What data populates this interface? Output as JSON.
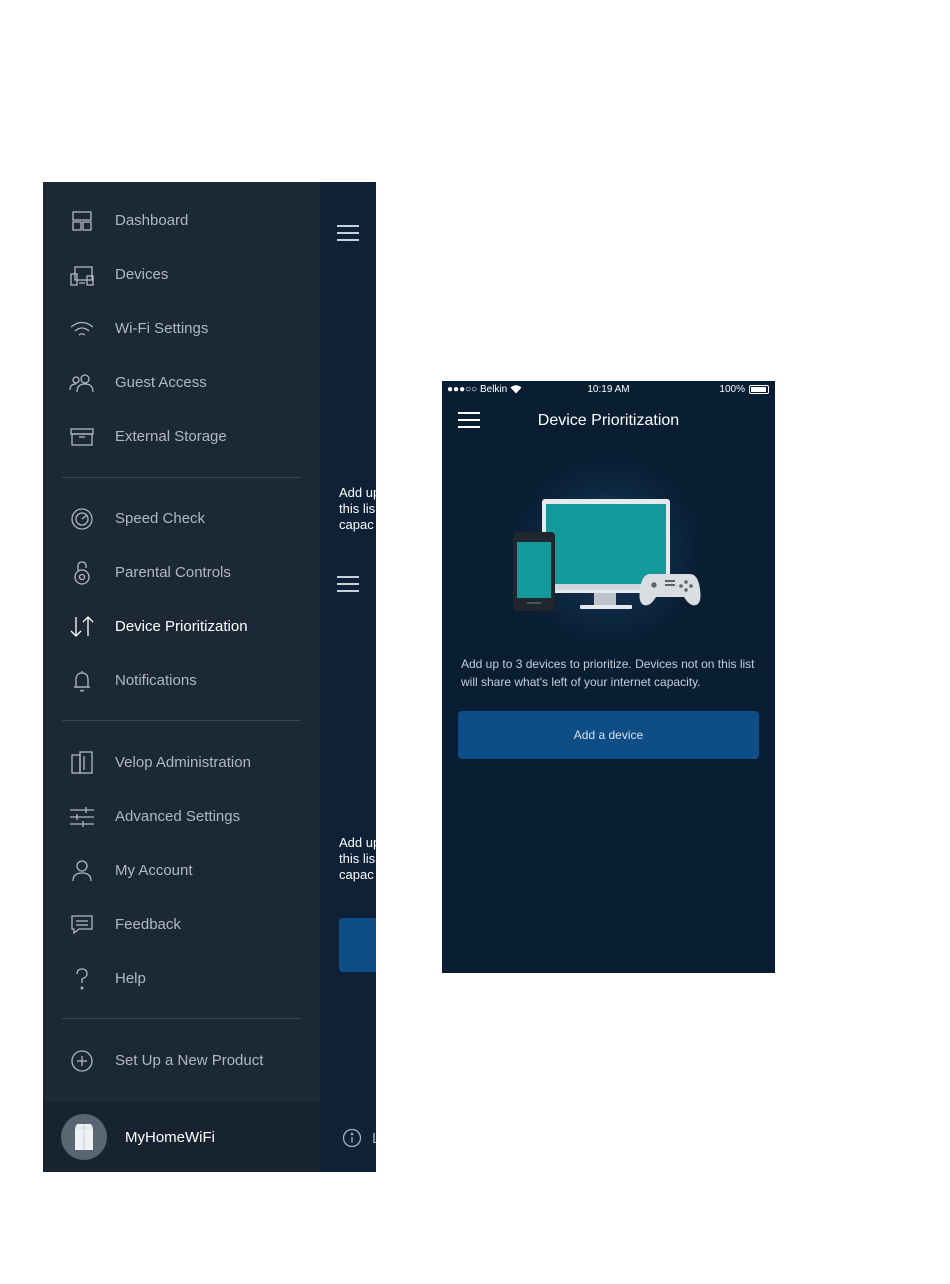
{
  "menu": {
    "items": [
      {
        "label": "Dashboard",
        "icon": "dashboard-icon"
      },
      {
        "label": "Devices",
        "icon": "devices-icon"
      },
      {
        "label": "Wi-Fi Settings",
        "icon": "wifi-icon"
      },
      {
        "label": "Guest Access",
        "icon": "guest-access-icon"
      },
      {
        "label": "External Storage",
        "icon": "storage-icon"
      },
      {
        "label": "Speed Check",
        "icon": "speedometer-icon"
      },
      {
        "label": "Parental Controls",
        "icon": "lock-icon"
      },
      {
        "label": "Device Prioritization",
        "icon": "up-down-arrows-icon",
        "active": true
      },
      {
        "label": "Notifications",
        "icon": "bell-icon"
      },
      {
        "label": "Velop Administration",
        "icon": "velop-node-icon"
      },
      {
        "label": "Advanced Settings",
        "icon": "sliders-icon"
      },
      {
        "label": "My Account",
        "icon": "user-icon"
      },
      {
        "label": "Feedback",
        "icon": "chat-icon"
      },
      {
        "label": "Help",
        "icon": "question-icon"
      },
      {
        "label": "Set Up a New Product",
        "icon": "plus-circle-icon"
      }
    ],
    "network_name": "MyHomeWiFi"
  },
  "peek": {
    "text_top": "Add up\nthis lis\ncapac",
    "text_bottom": "Add up\nthis lis\ncapac",
    "info_text": "L"
  },
  "status_bar": {
    "carrier": "●●●○○ Belkin",
    "time": "10:19 AM",
    "battery": "100%"
  },
  "screen": {
    "title": "Device Prioritization",
    "description": "Add up to 3 devices to prioritize. Devices not on this list will share what's left of your internet capacity.",
    "add_button": "Add a device"
  },
  "colors": {
    "menu_bg": "#1d2837",
    "screen_bg": "#0a1e33",
    "button_blue": "#0e4d86"
  }
}
